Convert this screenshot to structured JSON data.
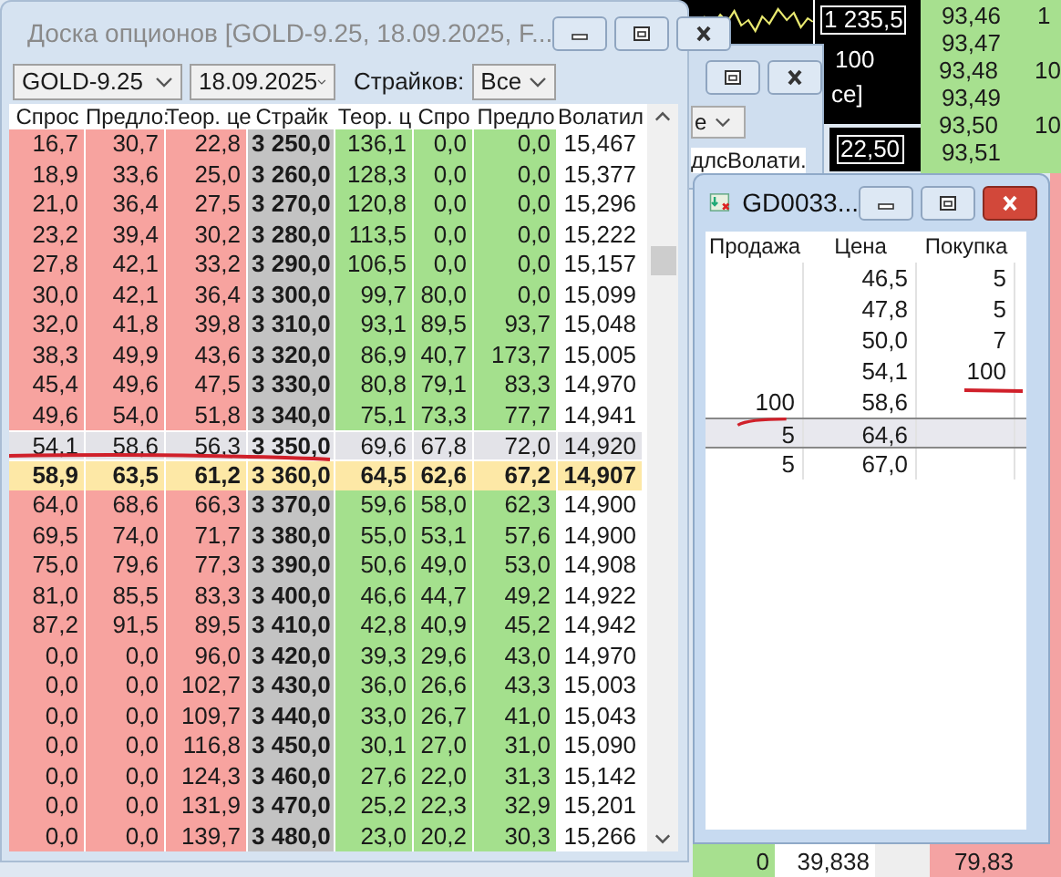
{
  "background": {
    "chart_price": "1 235,5",
    "chart_label": "100",
    "chart_caption": "ce]",
    "chart_price_2": "22,50",
    "price_column": [
      {
        "price": "93,46",
        "size": "1"
      },
      {
        "price": "93,47"
      },
      {
        "price": "93,48",
        "size": "10"
      },
      {
        "price": "93,49"
      },
      {
        "price": "93,50",
        "size": "10"
      },
      {
        "price": "93,51"
      }
    ],
    "back_window": {
      "dropdown": "e",
      "header": "длсВолати."
    },
    "bottom_cells": [
      "0",
      "39,838",
      "79,83"
    ]
  },
  "options_window": {
    "title": "Доска опционов [GOLD-9.25, 18.09.2025, F...",
    "instrument": "GOLD-9.25",
    "expiry": "18.09.2025",
    "strikes_label": "Страйков:",
    "strikes_value": "Все",
    "columns": [
      "Спрос",
      "Предло:",
      "Теор. це",
      "Страйк",
      "Теор. ц",
      "Спро",
      "Предло",
      "Волатил"
    ],
    "rows": [
      {
        "cells": [
          "16,7",
          "30,7",
          "22,8",
          "3 250,0",
          "136,1",
          "0,0",
          "0,0",
          "15,467"
        ],
        "selected": false,
        "highlighted": false
      },
      {
        "cells": [
          "18,9",
          "33,6",
          "25,0",
          "3 260,0",
          "128,3",
          "0,0",
          "0,0",
          "15,377"
        ],
        "selected": false,
        "highlighted": false
      },
      {
        "cells": [
          "21,0",
          "36,4",
          "27,5",
          "3 270,0",
          "120,8",
          "0,0",
          "0,0",
          "15,296"
        ],
        "selected": false,
        "highlighted": false
      },
      {
        "cells": [
          "23,2",
          "39,4",
          "30,2",
          "3 280,0",
          "113,5",
          "0,0",
          "0,0",
          "15,222"
        ],
        "selected": false,
        "highlighted": false
      },
      {
        "cells": [
          "27,8",
          "42,1",
          "33,2",
          "3 290,0",
          "106,5",
          "0,0",
          "0,0",
          "15,157"
        ],
        "selected": false,
        "highlighted": false
      },
      {
        "cells": [
          "30,0",
          "42,1",
          "36,4",
          "3 300,0",
          "99,7",
          "80,0",
          "0,0",
          "15,099"
        ],
        "selected": false,
        "highlighted": false
      },
      {
        "cells": [
          "32,0",
          "41,8",
          "39,8",
          "3 310,0",
          "93,1",
          "89,5",
          "93,7",
          "15,048"
        ],
        "selected": false,
        "highlighted": false
      },
      {
        "cells": [
          "38,3",
          "49,9",
          "43,6",
          "3 320,0",
          "86,9",
          "40,7",
          "173,7",
          "15,005"
        ],
        "selected": false,
        "highlighted": false
      },
      {
        "cells": [
          "45,4",
          "49,6",
          "47,5",
          "3 330,0",
          "80,8",
          "79,1",
          "83,3",
          "14,970"
        ],
        "selected": false,
        "highlighted": false
      },
      {
        "cells": [
          "49,6",
          "54,0",
          "51,8",
          "3 340,0",
          "75,1",
          "73,3",
          "77,7",
          "14,941"
        ],
        "selected": false,
        "highlighted": false
      },
      {
        "cells": [
          "54,1",
          "58,6",
          "56,3",
          "3 350,0",
          "69,6",
          "67,8",
          "72,0",
          "14,920"
        ],
        "selected": true,
        "highlighted": false
      },
      {
        "cells": [
          "58,9",
          "63,5",
          "61,2",
          "3 360,0",
          "64,5",
          "62,6",
          "67,2",
          "14,907"
        ],
        "selected": false,
        "highlighted": true
      },
      {
        "cells": [
          "64,0",
          "68,6",
          "66,3",
          "3 370,0",
          "59,6",
          "58,0",
          "62,3",
          "14,900"
        ],
        "selected": false,
        "highlighted": false
      },
      {
        "cells": [
          "69,5",
          "74,0",
          "71,7",
          "3 380,0",
          "55,0",
          "53,1",
          "57,6",
          "14,900"
        ],
        "selected": false,
        "highlighted": false
      },
      {
        "cells": [
          "75,0",
          "79,6",
          "77,3",
          "3 390,0",
          "50,6",
          "49,0",
          "53,0",
          "14,908"
        ],
        "selected": false,
        "highlighted": false
      },
      {
        "cells": [
          "81,0",
          "85,5",
          "83,3",
          "3 400,0",
          "46,6",
          "44,7",
          "49,2",
          "14,922"
        ],
        "selected": false,
        "highlighted": false
      },
      {
        "cells": [
          "87,2",
          "91,5",
          "89,5",
          "3 410,0",
          "42,8",
          "40,9",
          "45,2",
          "14,942"
        ],
        "selected": false,
        "highlighted": false
      },
      {
        "cells": [
          "0,0",
          "0,0",
          "96,0",
          "3 420,0",
          "39,3",
          "29,6",
          "43,0",
          "14,970"
        ],
        "selected": false,
        "highlighted": false
      },
      {
        "cells": [
          "0,0",
          "0,0",
          "102,7",
          "3 430,0",
          "36,0",
          "26,6",
          "43,3",
          "15,003"
        ],
        "selected": false,
        "highlighted": false
      },
      {
        "cells": [
          "0,0",
          "0,0",
          "109,7",
          "3 440,0",
          "33,0",
          "26,7",
          "41,0",
          "15,043"
        ],
        "selected": false,
        "highlighted": false
      },
      {
        "cells": [
          "0,0",
          "0,0",
          "116,8",
          "3 450,0",
          "30,1",
          "27,0",
          "31,0",
          "15,090"
        ],
        "selected": false,
        "highlighted": false
      },
      {
        "cells": [
          "0,0",
          "0,0",
          "124,3",
          "3 460,0",
          "27,6",
          "22,0",
          "31,3",
          "15,142"
        ],
        "selected": false,
        "highlighted": false
      },
      {
        "cells": [
          "0,0",
          "0,0",
          "131,9",
          "3 470,0",
          "25,2",
          "22,3",
          "32,9",
          "15,201"
        ],
        "selected": false,
        "highlighted": false
      },
      {
        "cells": [
          "0,0",
          "0,0",
          "139,7",
          "3 480,0",
          "23,0",
          "20,2",
          "30,3",
          "15,266"
        ],
        "selected": false,
        "highlighted": false
      }
    ]
  },
  "order_book_window": {
    "title": "GD0033...",
    "columns": [
      "Продажа",
      "Цена",
      "Покупка"
    ],
    "rows": [
      {
        "price": "46,5",
        "buy": "5",
        "selected": false
      },
      {
        "price": "47,8",
        "buy": "5",
        "selected": false
      },
      {
        "price": "50,0",
        "buy": "7",
        "selected": false
      },
      {
        "price": "54,1",
        "buy": "100",
        "selected": false
      },
      {
        "sell": "100",
        "price": "58,6",
        "selected": false
      },
      {
        "sell": "5",
        "price": "64,6",
        "selected": true
      },
      {
        "sell": "5",
        "price": "67,0",
        "selected": false
      }
    ]
  }
}
